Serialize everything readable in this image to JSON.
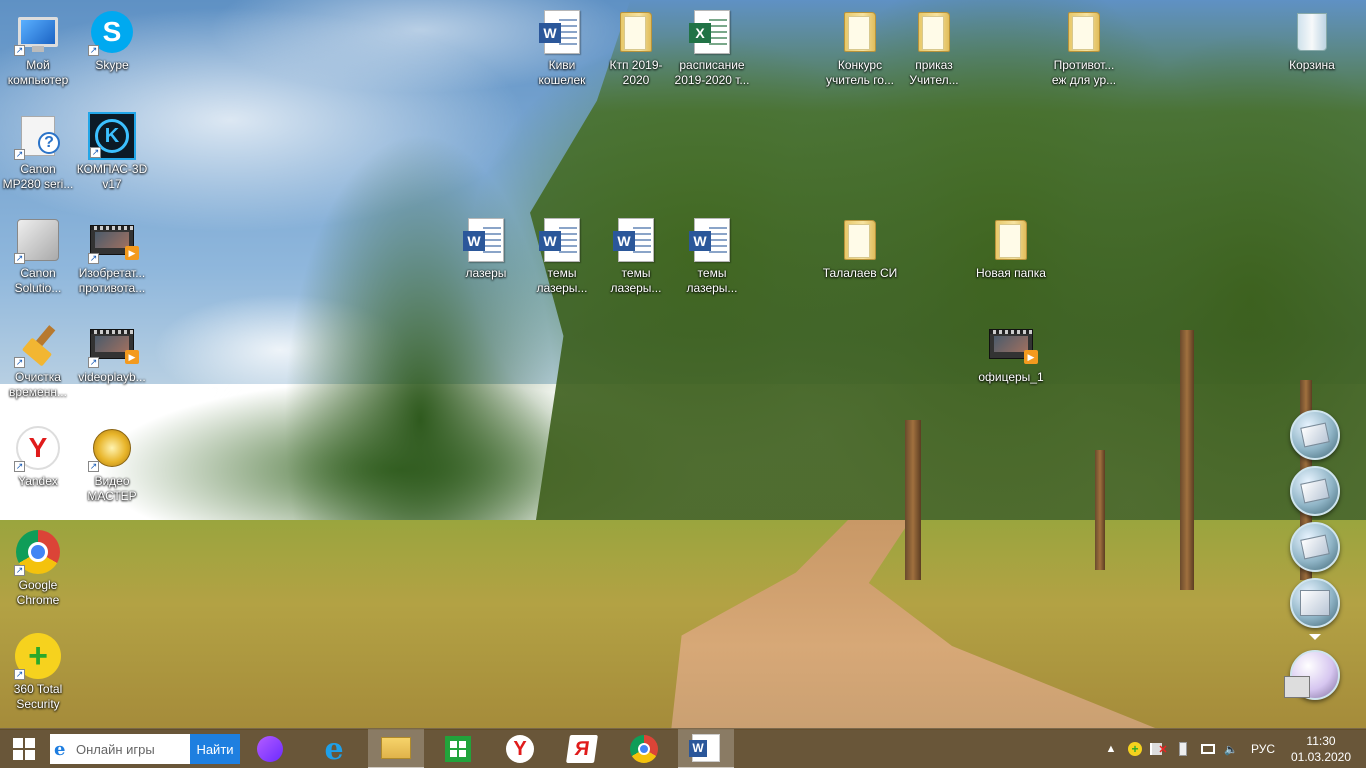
{
  "desktop": {
    "icons_left": [
      {
        "label": "Мой компьютер",
        "icon": "computer-icon",
        "shortcut": true
      },
      {
        "label": "Skype",
        "icon": "skype-icon",
        "shortcut": true
      },
      {
        "label": "Canon MP280 seri...",
        "icon": "printer-help-icon",
        "shortcut": true
      },
      {
        "label": "КОМПАС-3D v17",
        "icon": "kompas-icon",
        "shortcut": true
      },
      {
        "label": "Canon Solutio...",
        "icon": "canon-solution-icon",
        "shortcut": true
      },
      {
        "label": "Изобретат... противота...",
        "icon": "video-file-icon",
        "shortcut": true
      },
      {
        "label": "Очистка временн...",
        "icon": "broom-icon",
        "shortcut": true
      },
      {
        "label": "videoplayb...",
        "icon": "video-file-icon",
        "shortcut": true
      },
      {
        "label": "Yandex",
        "icon": "yandex-icon",
        "shortcut": true
      },
      {
        "label": "Видео МАСТЕР",
        "icon": "video-master-icon",
        "shortcut": true
      },
      {
        "label": "Google Chrome",
        "icon": "chrome-icon",
        "shortcut": true
      },
      {
        "label": "360 Total Security",
        "icon": "360-security-icon",
        "shortcut": true
      }
    ],
    "icons_top": [
      {
        "label": "Киви кошелек",
        "icon": "word-document-icon"
      },
      {
        "label": "Ктп 2019-2020",
        "icon": "folder-icon"
      },
      {
        "label": "расписание 2019-2020 т...",
        "icon": "excel-document-icon"
      },
      {
        "label": "Конкурс учитель го...",
        "icon": "folder-icon"
      },
      {
        "label": "приказ Учител...",
        "icon": "folder-icon"
      },
      {
        "label": "Противот... еж для ур...",
        "icon": "folder-icon"
      },
      {
        "label": "Корзина",
        "icon": "recycle-bin-icon"
      }
    ],
    "icons_middle": [
      {
        "label": "лазеры",
        "icon": "word-document-icon"
      },
      {
        "label": "темы лазеры...",
        "icon": "word-document-icon"
      },
      {
        "label": "темы лазеры...",
        "icon": "word-document-icon"
      },
      {
        "label": "темы лазеры...",
        "icon": "word-document-icon"
      },
      {
        "label": "Талалаев СИ",
        "icon": "folder-icon"
      },
      {
        "label": "Новая папка",
        "icon": "folder-icon"
      },
      {
        "label": "офицеры_1",
        "icon": "video-file-icon"
      }
    ],
    "gadgets": [
      "photo-gadget-icon",
      "photo-gadget-icon",
      "photo-gadget-icon",
      "solution-menu-gadget-icon",
      "solution-menu-gadget-icon"
    ]
  },
  "taskbar": {
    "search_placeholder": "Онлайн игры",
    "search_button": "Найти",
    "pinned": [
      "alice-icon",
      "internet-explorer-icon",
      "file-explorer-icon",
      "store-icon",
      "yandex-browser-icon",
      "yandex-icon",
      "chrome-icon",
      "word-icon"
    ],
    "tray": {
      "language": "РУС",
      "time": "11:30",
      "date": "01.03.2020"
    }
  },
  "colors": {
    "taskbar": "#5c4828",
    "search_button": "#1e7fe0",
    "word_blue": "#2b579a",
    "excel_green": "#217346"
  }
}
